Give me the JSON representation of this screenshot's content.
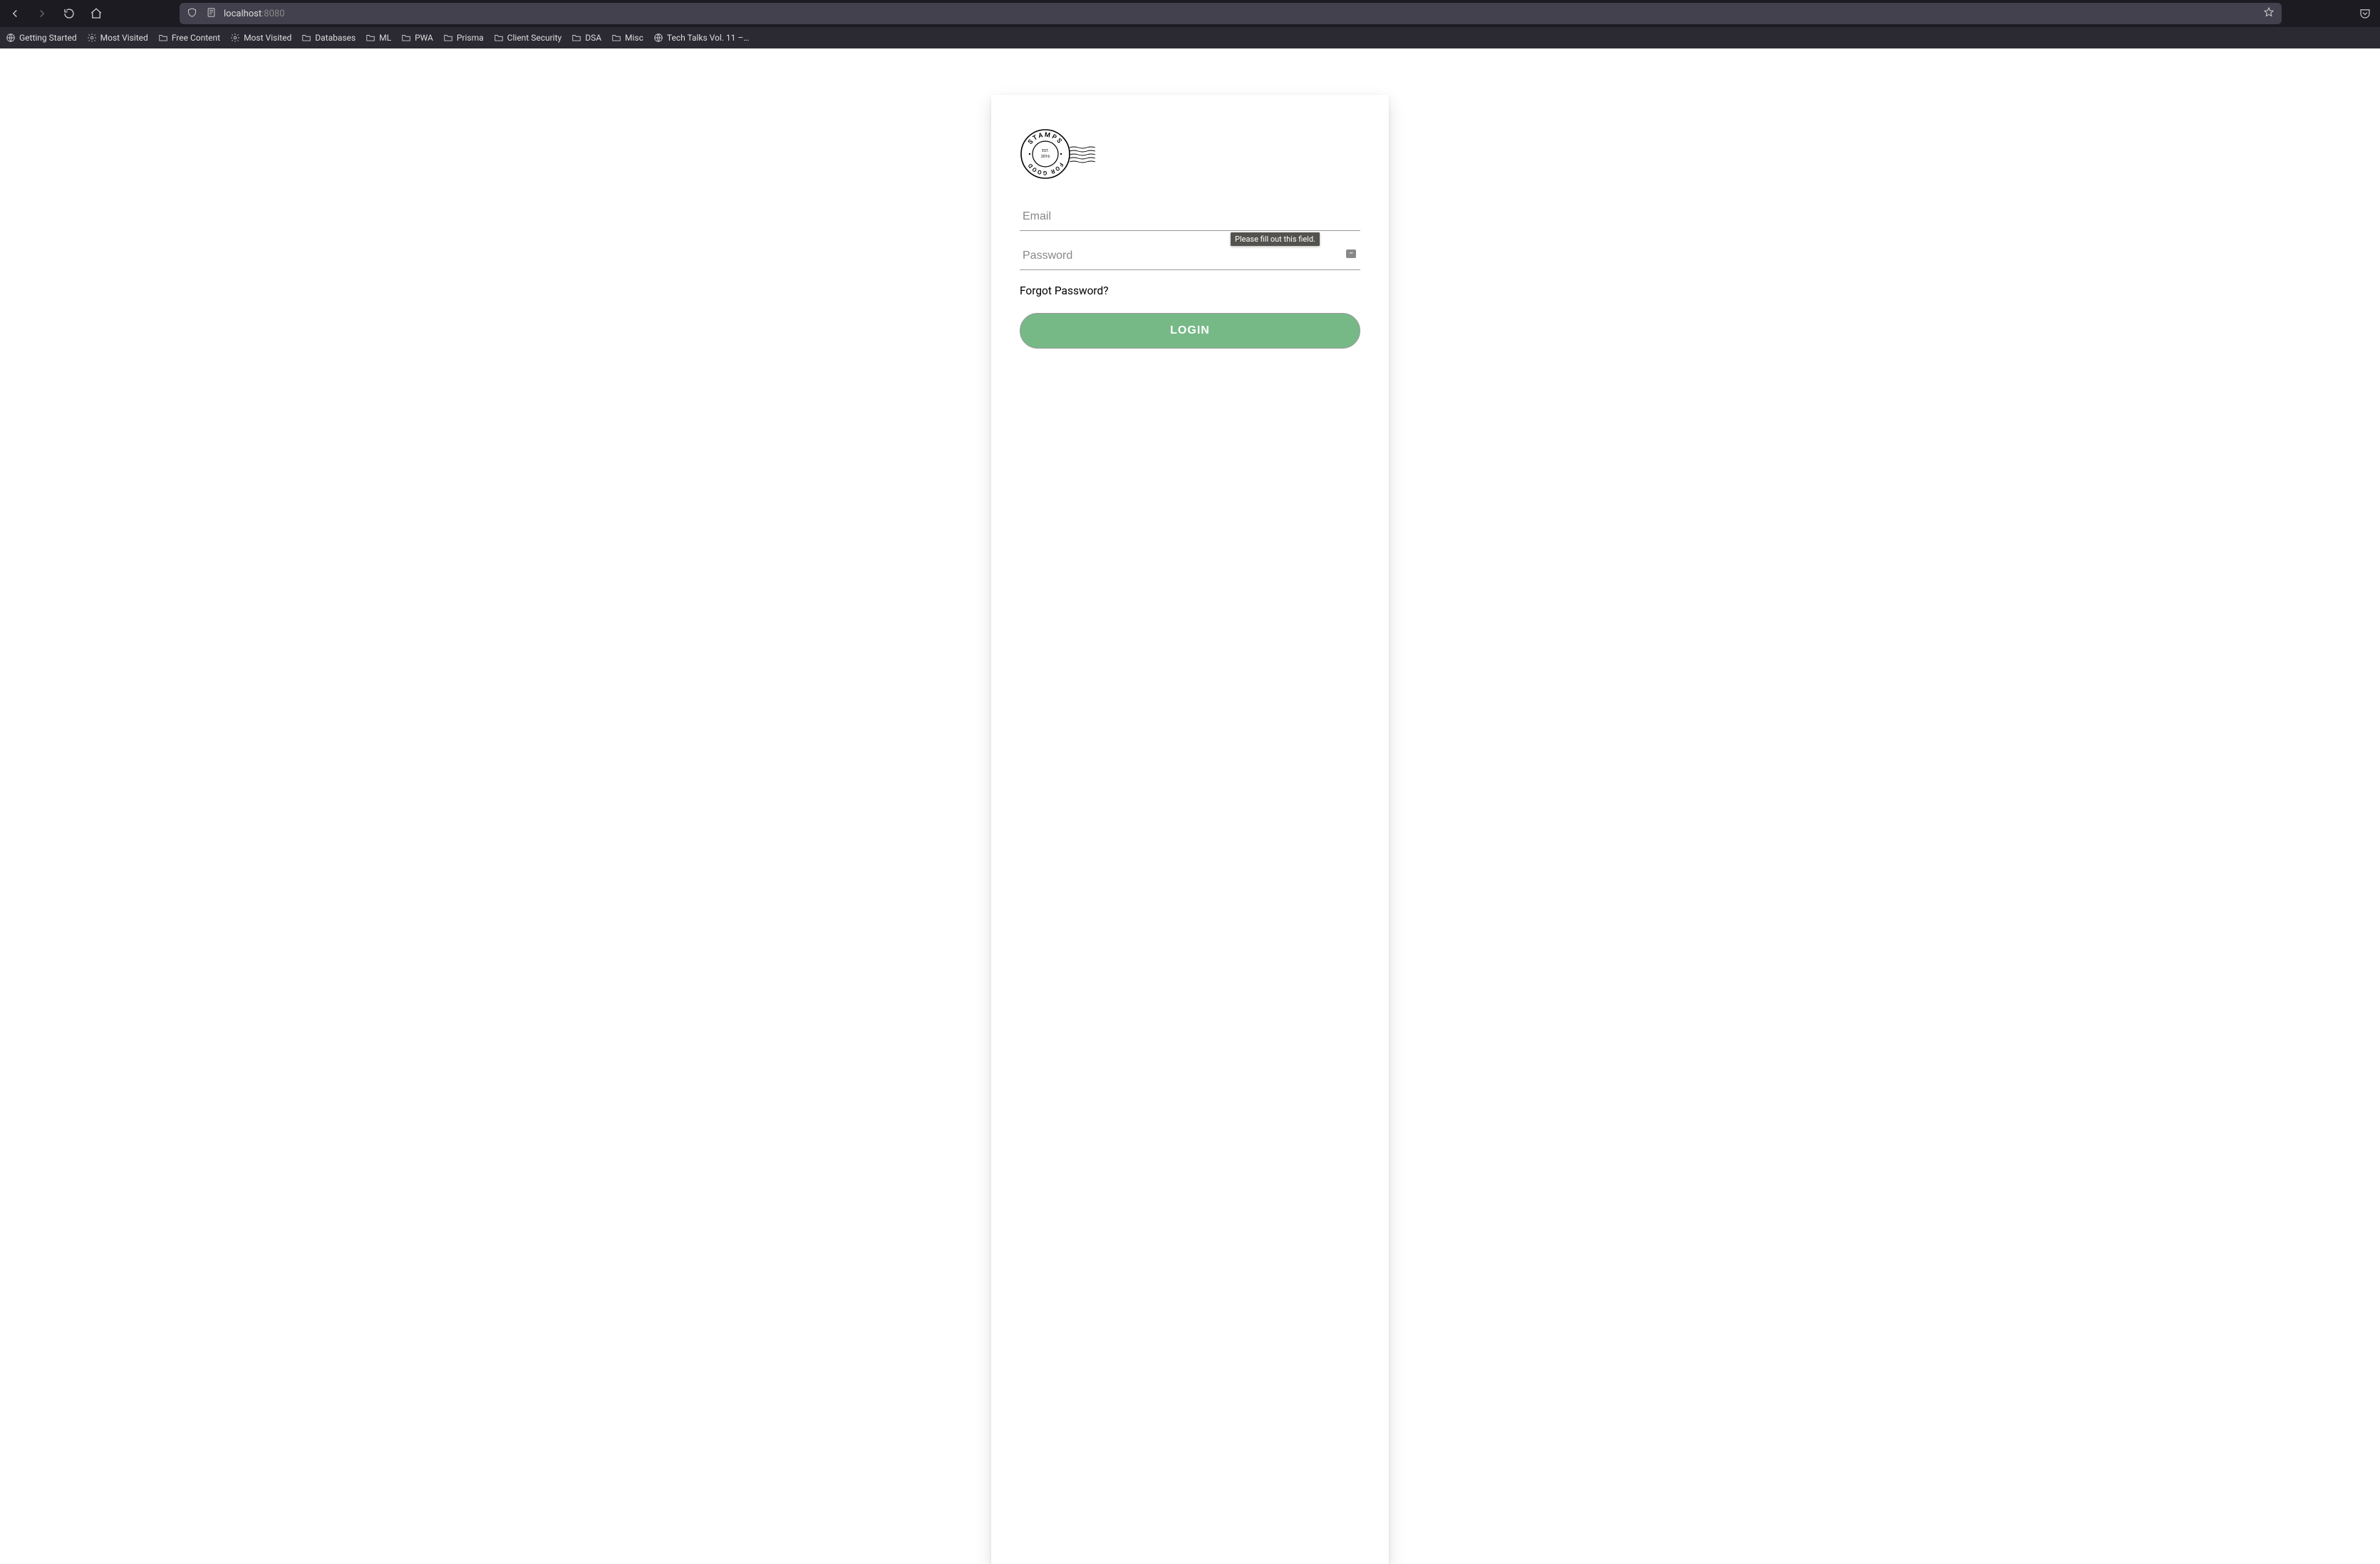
{
  "browser": {
    "url_host": "localhost",
    "url_port": ":8080"
  },
  "bookmarks": [
    {
      "label": "Getting Started",
      "icon": "globe"
    },
    {
      "label": "Most Visited",
      "icon": "gear"
    },
    {
      "label": "Free Content",
      "icon": "folder"
    },
    {
      "label": "Most Visited",
      "icon": "gear"
    },
    {
      "label": "Databases",
      "icon": "folder"
    },
    {
      "label": "ML",
      "icon": "folder"
    },
    {
      "label": "PWA",
      "icon": "folder"
    },
    {
      "label": "Prisma",
      "icon": "folder"
    },
    {
      "label": "Client Security",
      "icon": "folder"
    },
    {
      "label": "DSA",
      "icon": "folder"
    },
    {
      "label": "Misc",
      "icon": "folder"
    },
    {
      "label": "Tech Talks Vol. 11 –…",
      "icon": "globe"
    }
  ],
  "logo": {
    "top_text": "STAMPS",
    "bottom_text": "FOR GOOD",
    "est_label": "EST.",
    "est_year": "2016"
  },
  "form": {
    "email_placeholder": "Email",
    "password_placeholder": "Password",
    "validation_message": "Please fill out this field.",
    "forgot_link": "Forgot Password?",
    "login_button": "LOGIN"
  }
}
